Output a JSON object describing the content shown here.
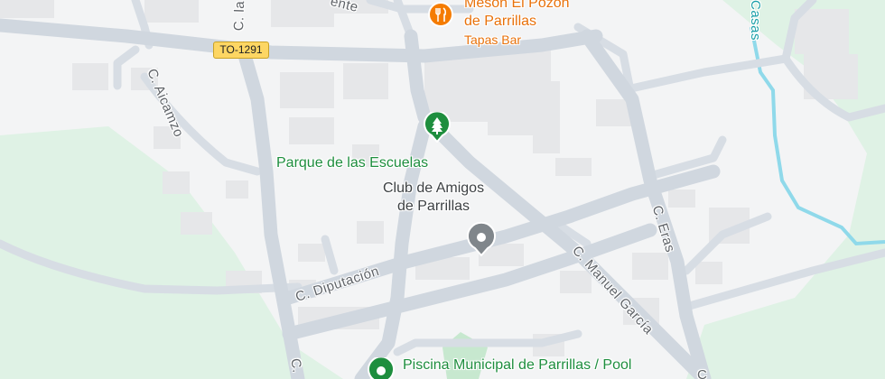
{
  "colors": {
    "background": "#f3f4f5",
    "green_area": "#dff2e5",
    "road": "#d7dde4",
    "building": "#e6e7e9",
    "water": "#8fd9ea",
    "green_poi": "#1e8e3e",
    "orange_poi": "#f57c00",
    "gray_poi": "#80868b",
    "shield": "#fdd663"
  },
  "road_shield": {
    "label": "TO-1291"
  },
  "streets": {
    "c_la": "C. la",
    "c_aicamzo": "C. Aicamzo",
    "c_diputacion": "C. Diputación",
    "c_manuel_garcia": "C. Manuel García",
    "c_eras": "C. Eras",
    "c_bottom": "C.",
    "top_fragment": "ente",
    "right_edge_fragment": "C"
  },
  "water_label": "Casas",
  "pois": {
    "meson": {
      "name_line1": "Mesón El Pozón",
      "name_line2": "de Parrillas",
      "category": "Tapas Bar",
      "icon": "restaurant-icon"
    },
    "parque": {
      "name": "Parque de las Escuelas",
      "icon": "tree-icon"
    },
    "club": {
      "name_line1": "Club de Amigos",
      "name_line2": "de Parrillas",
      "icon": "place-icon"
    },
    "piscina": {
      "name": "Piscina Municipal de Parrillas / Pool",
      "icon": "place-icon"
    }
  }
}
